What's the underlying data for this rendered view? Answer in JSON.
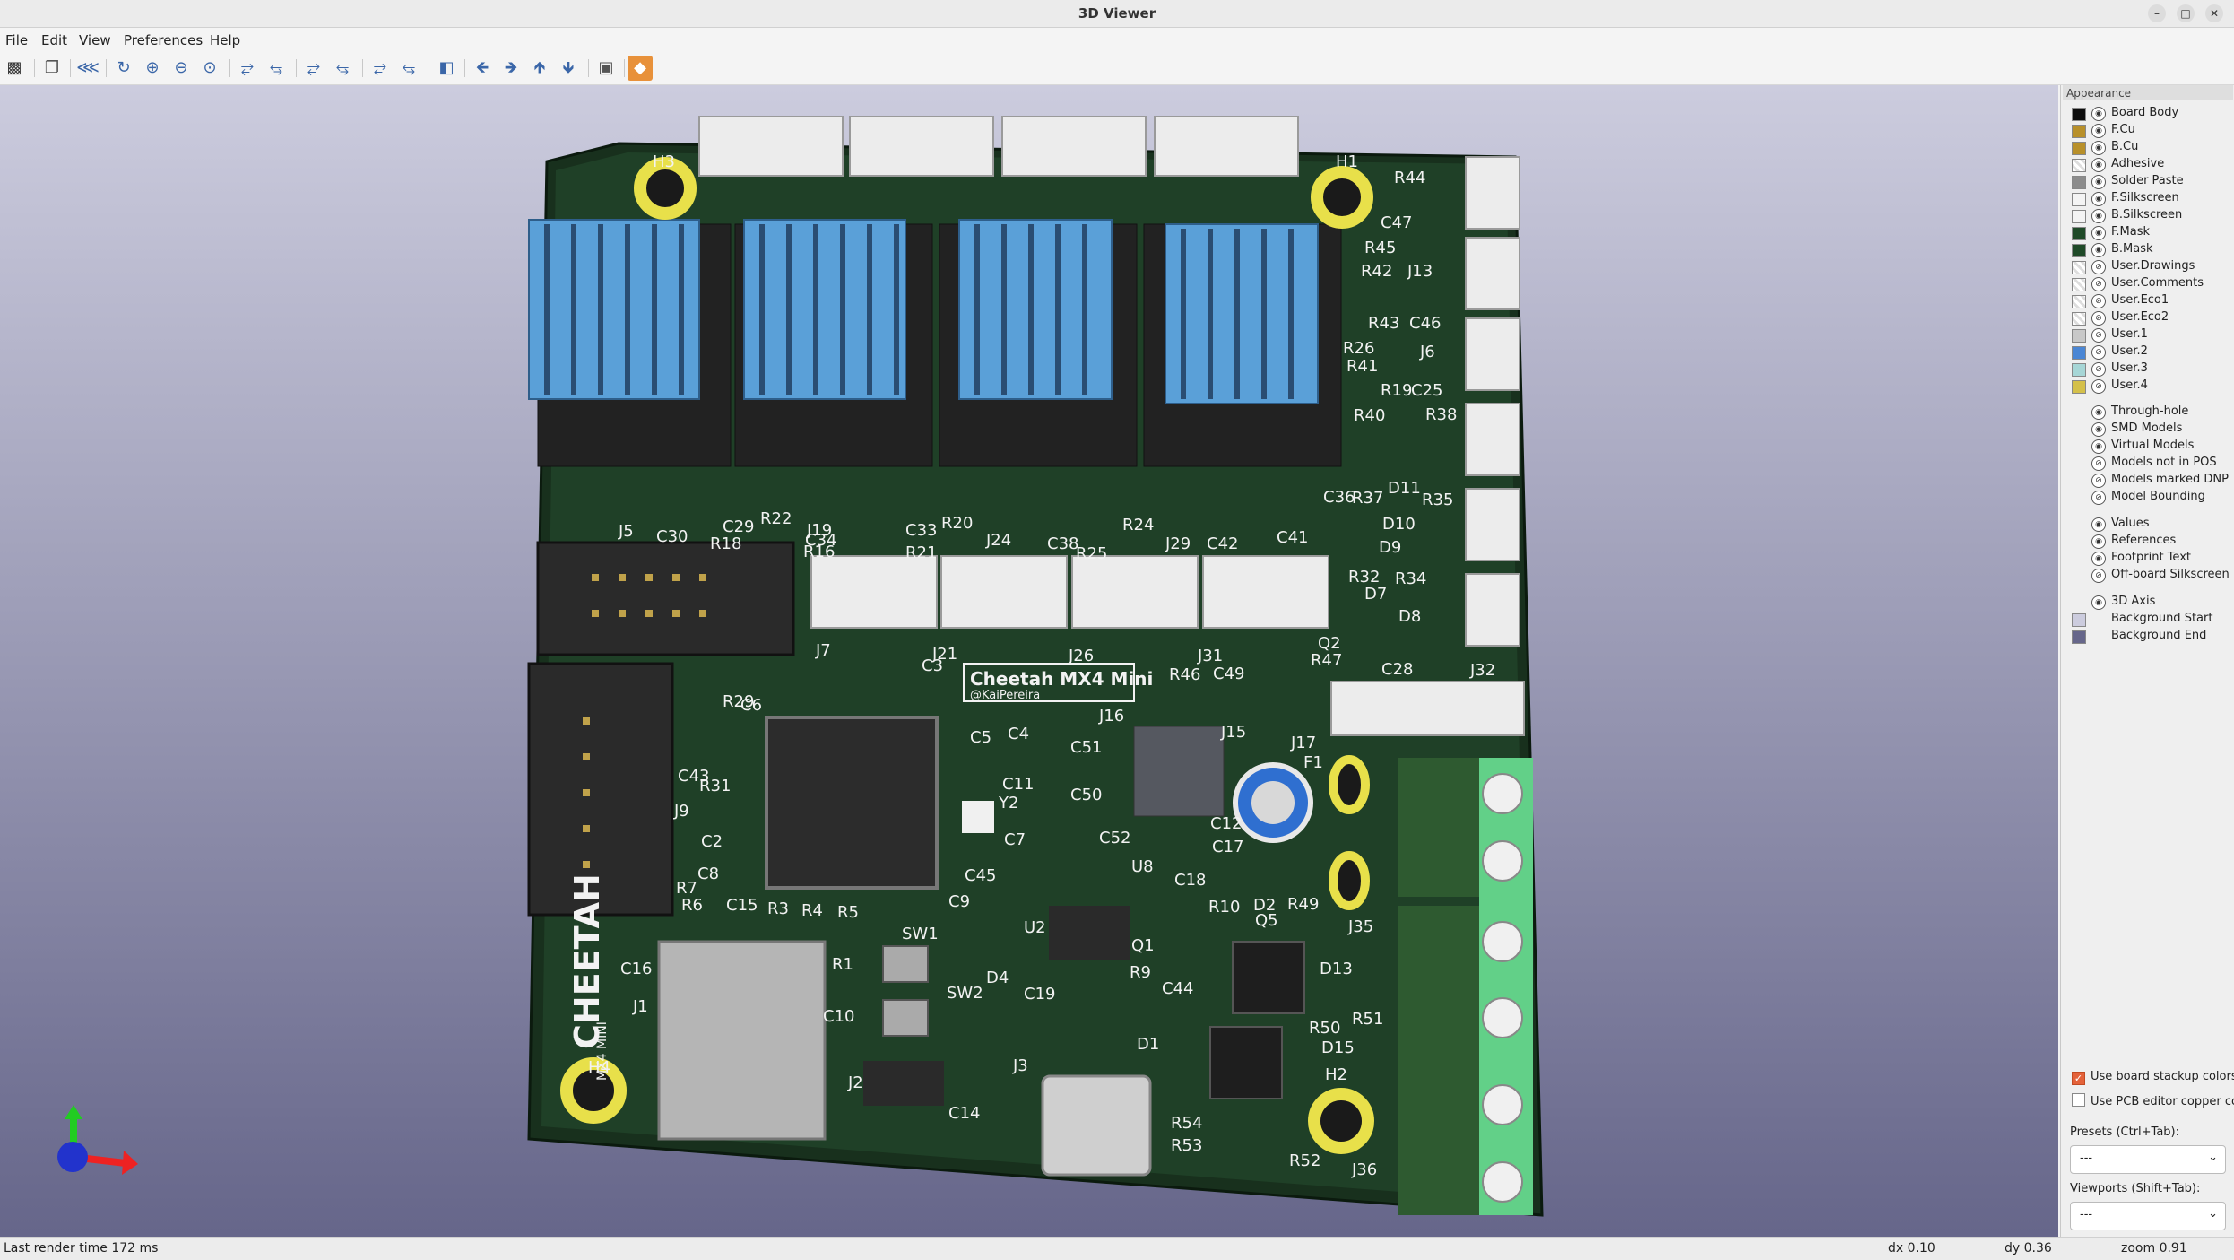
{
  "window": {
    "title": "3D Viewer"
  },
  "menu": [
    "File",
    "Edit",
    "View",
    "Preferences",
    "Help"
  ],
  "toolbar": {
    "icons": [
      "export-icon",
      "copy-icon",
      "raytrace-icon",
      "reload-icon",
      "zoom-in-icon",
      "zoom-out-icon",
      "zoom-fit-icon",
      "rotate-x-cw-icon",
      "rotate-x-ccw-icon",
      "rotate-y-cw-icon",
      "rotate-y-ccw-icon",
      "rotate-z-cw-icon",
      "rotate-z-ccw-icon",
      "flip-board-icon",
      "move-left-icon",
      "move-right-icon",
      "move-up-icon",
      "move-down-icon",
      "orthographic-icon",
      "render-mode-icon"
    ]
  },
  "board": {
    "title": "Cheetah MX4 Mini",
    "author": "@KaiPereira",
    "logo": "CHEETAH",
    "logo_sub": "MX4 MINI",
    "refs": [
      "H3",
      "H1",
      "H4",
      "H2",
      "R44",
      "C47",
      "R45",
      "R42",
      "J13",
      "R43",
      "C46",
      "R26",
      "J6",
      "R41",
      "R19",
      "C25",
      "R40",
      "R38",
      "C36",
      "R37",
      "D11",
      "R35",
      "D10",
      "D9",
      "R32",
      "R34",
      "D7",
      "D8",
      "J5",
      "C30",
      "C29",
      "R22",
      "J19",
      "C34",
      "C33",
      "R20",
      "J24",
      "C38",
      "R25",
      "R24",
      "J29",
      "C42",
      "C41",
      "J7",
      "J21",
      "J26",
      "J31",
      "Q2",
      "R47",
      "C28",
      "J32",
      "J16",
      "R46",
      "C49",
      "J15",
      "J17",
      "F1",
      "C5",
      "C4",
      "C51",
      "C50",
      "C11",
      "Y2",
      "C7",
      "C45",
      "C52",
      "C17",
      "C12",
      "U8",
      "C18",
      "R10",
      "D2",
      "R49",
      "Q5",
      "J35",
      "D13",
      "U2",
      "Q1",
      "R9",
      "C44",
      "R50",
      "R51",
      "D15",
      "D4",
      "SW2",
      "C19",
      "R1",
      "SW1",
      "C10",
      "D1",
      "J3",
      "R54",
      "R53",
      "R52",
      "J36",
      "J2",
      "C14",
      "J1",
      "C16",
      "C43",
      "R31",
      "J9",
      "C2",
      "R7",
      "C8",
      "R6",
      "C15",
      "R3",
      "R4",
      "R5",
      "C9",
      "R29",
      "C6",
      "C3",
      "R18",
      "R16",
      "R21"
    ]
  },
  "appearance": {
    "title": "Appearance",
    "layers": [
      {
        "name": "Board Body",
        "color": "#0d0d0d"
      },
      {
        "name": "F.Cu",
        "color": "#b8902a"
      },
      {
        "name": "B.Cu",
        "color": "#b8902a"
      },
      {
        "name": "Adhesive",
        "color": ""
      },
      {
        "name": "Solder Paste",
        "color": "#8c8c8c"
      },
      {
        "name": "F.Silkscreen",
        "color": "#f4f4f4"
      },
      {
        "name": "B.Silkscreen",
        "color": "#f4f4f4"
      },
      {
        "name": "F.Mask",
        "color": "#1f4a28"
      },
      {
        "name": "B.Mask",
        "color": "#1f4a28"
      },
      {
        "name": "User.Drawings",
        "color": ""
      },
      {
        "name": "User.Comments",
        "color": ""
      },
      {
        "name": "User.Eco1",
        "color": ""
      },
      {
        "name": "User.Eco2",
        "color": ""
      },
      {
        "name": "User.1",
        "color": "#c8c8c8"
      },
      {
        "name": "User.2",
        "color": "#4a86d4"
      },
      {
        "name": "User.3",
        "color": "#a6d6d6"
      },
      {
        "name": "User.4",
        "color": "#d4c04a"
      }
    ],
    "models": [
      "Through-hole",
      "SMD Models",
      "Virtual Models",
      "Models not in POS",
      "Models marked DNP",
      "Model Bounding"
    ],
    "texts": [
      "Values",
      "References",
      "Footprint Text",
      "Off-board Silkscreen"
    ],
    "axis": [
      {
        "name": "3D Axis",
        "color": ""
      },
      {
        "name": "Background Start",
        "color": "#ccccde"
      },
      {
        "name": "Background End",
        "color": "#66668a"
      }
    ],
    "use_stackup": "Use board stackup colors",
    "use_pcb_colors": "Use PCB editor copper colc",
    "presets_label": "Presets (Ctrl+Tab):",
    "presets_value": "---",
    "viewports_label": "Viewports (Shift+Tab):",
    "viewports_value": "---"
  },
  "status": {
    "render_time": "Last render time 172 ms",
    "dx": "dx 0.10",
    "dy": "dy 0.36",
    "zoom": "zoom 0.91"
  }
}
